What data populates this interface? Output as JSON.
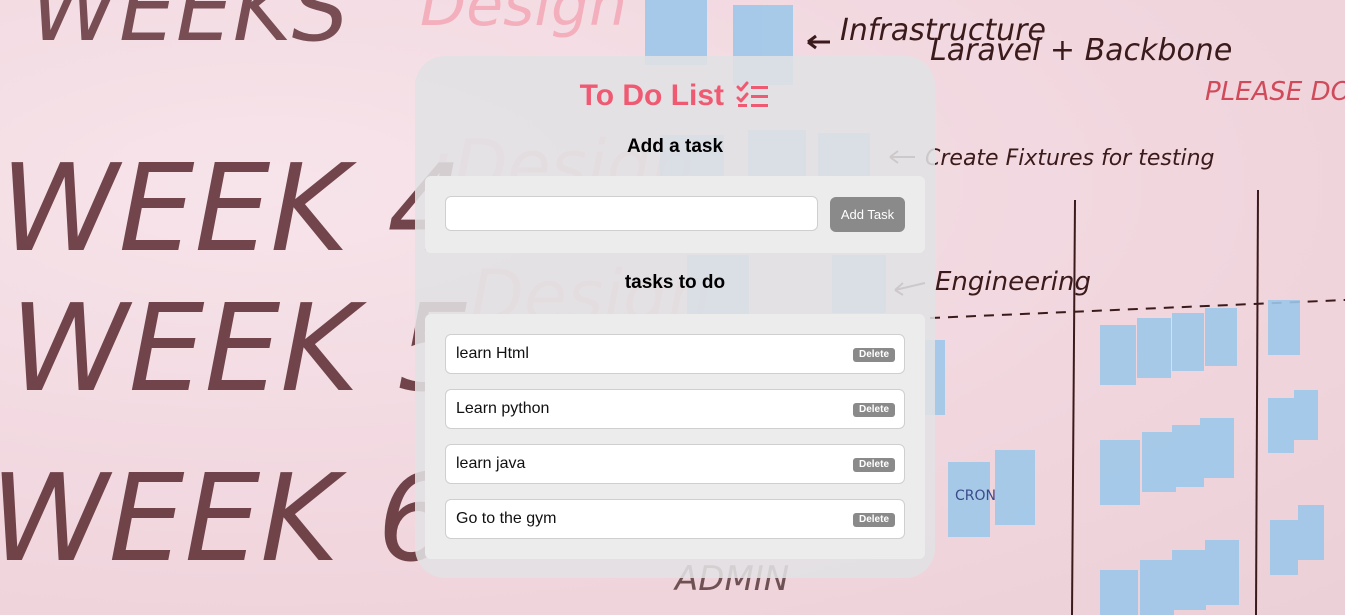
{
  "app": {
    "title": "To Do List",
    "title_icon": "checklist-icon",
    "accent_color": "#ef5a72"
  },
  "add_section": {
    "heading": "Add a task",
    "input_value": "",
    "button_label": "Add Task"
  },
  "todo_section": {
    "heading": "tasks to do",
    "delete_label": "Delete",
    "tasks": [
      {
        "text": "learn Html"
      },
      {
        "text": "Learn python"
      },
      {
        "text": "learn java"
      },
      {
        "text": "Go to the gym"
      }
    ]
  },
  "background": {
    "whiteboard_text": [
      "WEEK 4",
      "WEEK 5",
      "WEEK 6",
      "Design",
      "Laravel + Backbone",
      "Infrastructure",
      "Create Fixtures for testing",
      "Engineering",
      "PLEASE DO NOT ERA",
      "ADMIN",
      "CRON"
    ]
  }
}
